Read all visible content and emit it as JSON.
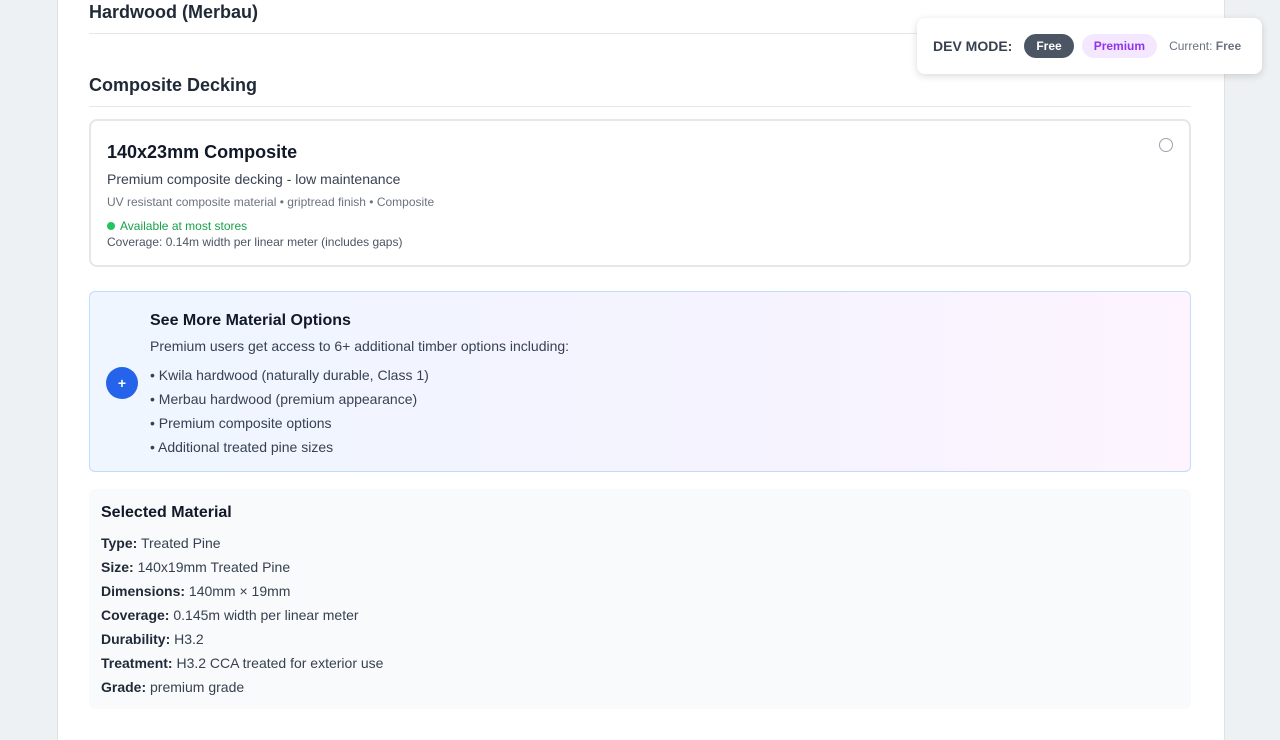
{
  "sections": {
    "hardwood_heading": "Hardwood (Merbau)",
    "composite_heading": "Composite Decking"
  },
  "composite_option": {
    "title": "140x23mm Composite",
    "description": "Premium composite decking - low maintenance",
    "specs": "UV resistant composite material • griptread finish • Composite",
    "availability": "Available at most stores",
    "coverage": "Coverage: 0.14m width per linear meter (includes gaps)",
    "selected": false
  },
  "upsell": {
    "button_label": "+",
    "title": "See More Material Options",
    "subtitle": "Premium users get access to 6+ additional timber options including:",
    "items": [
      "• Kwila hardwood (naturally durable, Class 1)",
      "• Merbau hardwood (premium appearance)",
      "• Premium composite options",
      "• Additional treated pine sizes"
    ]
  },
  "selected_material": {
    "title": "Selected Material",
    "rows": [
      {
        "label": "Type:",
        "value": "Treated Pine"
      },
      {
        "label": "Size:",
        "value": "140x19mm Treated Pine"
      },
      {
        "label": "Dimensions:",
        "value": "140mm × 19mm"
      },
      {
        "label": "Coverage:",
        "value": "0.145m width per linear meter"
      },
      {
        "label": "Durability:",
        "value": "H3.2"
      },
      {
        "label": "Treatment:",
        "value": "H3.2 CCA treated for exterior use"
      },
      {
        "label": "Grade:",
        "value": "premium grade"
      }
    ]
  },
  "dev_mode": {
    "label": "DEV MODE:",
    "free_label": "Free",
    "premium_label": "Premium",
    "current_prefix": "Current:",
    "current_value": "Free"
  },
  "colors": {
    "accent_blue": "#2563eb",
    "available_green": "#16a34a",
    "premium_purple": "#9333ea"
  }
}
